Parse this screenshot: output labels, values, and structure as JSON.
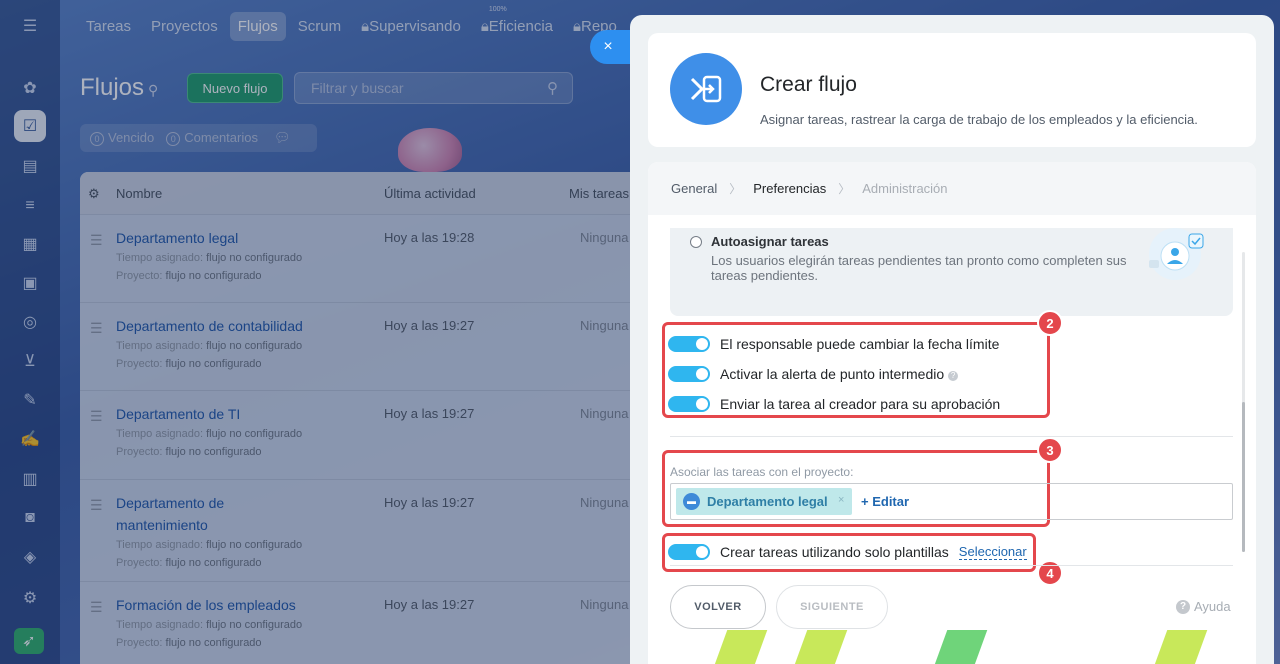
{
  "nav": {
    "tabs": [
      {
        "label": "Tareas"
      },
      {
        "label": "Proyectos"
      },
      {
        "label": "Flujos"
      },
      {
        "label": "Scrum"
      },
      {
        "label": "Supervisando"
      },
      {
        "label": "Eficiencia",
        "sup": "100%"
      },
      {
        "label": "Repo"
      }
    ]
  },
  "list": {
    "title": "Flujos",
    "new_button": "Nuevo flujo",
    "search_placeholder": "Filtrar y buscar",
    "counters": [
      {
        "count": "0",
        "label": "Vencido"
      },
      {
        "count": "0",
        "label": "Comentarios"
      }
    ],
    "columns": {
      "name": "Nombre",
      "activity": "Última actividad",
      "mine": "Mis tareas"
    },
    "rows": [
      {
        "name": "Departamento legal",
        "time_label": "Tiempo asignado:",
        "time_value": "flujo no configurado",
        "project_label": "Proyecto:",
        "project_value": "flujo no configurado",
        "activity": "Hoy a las 19:28",
        "mine": "Ninguna"
      },
      {
        "name": "Departamento de contabilidad",
        "time_label": "Tiempo asignado:",
        "time_value": "flujo no configurado",
        "project_label": "Proyecto:",
        "project_value": "flujo no configurado",
        "activity": "Hoy a las 19:27",
        "mine": "Ninguna"
      },
      {
        "name": "Departamento de TI",
        "time_label": "Tiempo asignado:",
        "time_value": "flujo no configurado",
        "project_label": "Proyecto:",
        "project_value": "flujo no configurado",
        "activity": "Hoy a las 19:27",
        "mine": "Ninguna"
      },
      {
        "name": "Departamento de mantenimiento",
        "time_label": "Tiempo asignado:",
        "time_value": "flujo no configurado",
        "project_label": "Proyecto:",
        "project_value": "flujo no configurado",
        "activity": "Hoy a las 19:27",
        "mine": "Ninguna"
      },
      {
        "name": "Formación de los empleados",
        "time_label": "Tiempo asignado:",
        "time_value": "flujo no configurado",
        "project_label": "Proyecto:",
        "project_value": "flujo no configurado",
        "activity": "Hoy a las 19:27",
        "mine": "Ninguna"
      }
    ]
  },
  "panel": {
    "close_icon": "×",
    "title": "Crear flujo",
    "subtitle": "Asignar tareas, rastrear la carga de trabajo de los empleados y la eficiencia.",
    "steps": [
      "General",
      "Preferencias",
      "Administración"
    ],
    "autoassign": {
      "title": "Autoasignar tareas",
      "description": "Los usuarios elegirán tareas pendientes tan pronto como completen sus tareas pendientes."
    },
    "toggles": [
      "El responsable puede cambiar la fecha límite",
      "Activar la alerta de punto intermedio",
      "Enviar la tarea al creador para su aprobación"
    ],
    "project": {
      "label": "Asociar las tareas con el proyecto:",
      "chip": "Departamento legal",
      "remove": "×",
      "edit": "+ Editar"
    },
    "templates": {
      "label": "Crear tareas utilizando solo plantillas",
      "select": "Seleccionar"
    },
    "badges": [
      "2",
      "3",
      "4"
    ],
    "back": "VOLVER",
    "next": "SIGUIENTE",
    "help": "Ayuda",
    "help_icon": "?"
  },
  "colors": {
    "accent": "#2fb6ef",
    "link": "#2067b0",
    "highlight": "#e4474c",
    "new_button": "#1f9d6a"
  }
}
